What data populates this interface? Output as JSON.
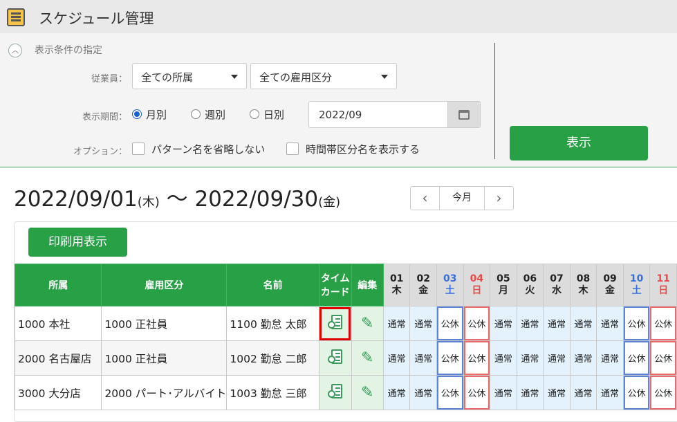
{
  "app": {
    "title": "スケジュール管理"
  },
  "conditions": {
    "section_title": "表示条件の指定",
    "employee_label": "従業員：",
    "dept_select": "全ての所属",
    "emptype_select": "全ての雇用区分",
    "period_label": "表示期間：",
    "period_options": [
      "月別",
      "週別",
      "日別"
    ],
    "period_selected": "月別",
    "date_value": "2022/09",
    "option_label": "オプション：",
    "option_pattern": "パターン名を省略しない",
    "option_timeband": "時間帯区分名を表示する",
    "show_button": "表示"
  },
  "range": {
    "start": "2022/09/01",
    "start_dow": "(木)",
    "tilde": "～",
    "end": "2022/09/30",
    "end_dow": "(金)"
  },
  "nav": {
    "prev": "‹",
    "today": "今月",
    "next": "›"
  },
  "print_button": "印刷用表示",
  "table": {
    "headers": {
      "dept": "所属",
      "emptype": "雇用区分",
      "name": "名前",
      "timecard_1": "タイム",
      "timecard_2": "カード",
      "edit": "編集"
    },
    "days": [
      {
        "d": "01",
        "w": "木",
        "kind": ""
      },
      {
        "d": "02",
        "w": "金",
        "kind": ""
      },
      {
        "d": "03",
        "w": "土",
        "kind": "sat"
      },
      {
        "d": "04",
        "w": "日",
        "kind": "sun"
      },
      {
        "d": "05",
        "w": "月",
        "kind": ""
      },
      {
        "d": "06",
        "w": "火",
        "kind": ""
      },
      {
        "d": "07",
        "w": "水",
        "kind": ""
      },
      {
        "d": "08",
        "w": "木",
        "kind": ""
      },
      {
        "d": "09",
        "w": "金",
        "kind": ""
      },
      {
        "d": "10",
        "w": "土",
        "kind": "sat"
      },
      {
        "d": "11",
        "w": "日",
        "kind": "sun"
      }
    ],
    "rows": [
      {
        "dept": "1000 本社",
        "emptype": "1000 正社員",
        "name": "1100 勤怠 太郎",
        "cells": [
          "通常",
          "通常",
          "公休",
          "公休",
          "通常",
          "通常",
          "通常",
          "通常",
          "通常",
          "公休",
          "公休"
        ]
      },
      {
        "dept": "2000 名古屋店",
        "emptype": "1000 正社員",
        "name": "1002 勤怠 二郎",
        "cells": [
          "通常",
          "通常",
          "公休",
          "公休",
          "通常",
          "通常",
          "通常",
          "通常",
          "通常",
          "公休",
          "公休"
        ]
      },
      {
        "dept": "3000 大分店",
        "emptype": "2000 パート･アルバイト",
        "name": "1003 勤怠 三郎",
        "cells": [
          "通常",
          "通常",
          "公休",
          "公休",
          "通常",
          "通常",
          "通常",
          "通常",
          "通常",
          "公休",
          "公休"
        ]
      }
    ],
    "highlight_timecard_row": 0
  },
  "icons": {
    "timecard": "timecard-icon",
    "edit": "pencil-icon"
  }
}
